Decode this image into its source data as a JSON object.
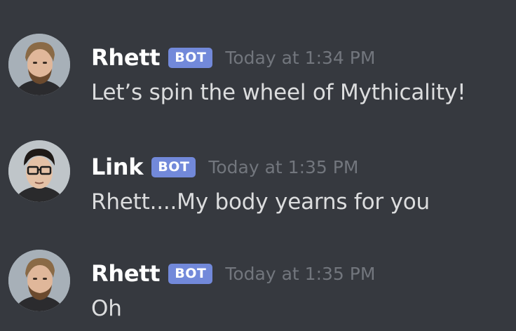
{
  "messages": [
    {
      "username": "Rhett",
      "tag": "BOT",
      "timestamp": "Today at 1:34 PM",
      "text": "Let’s spin the wheel of Mythicality!",
      "avatar_icon": "rhett-avatar-icon"
    },
    {
      "username": "Link",
      "tag": "BOT",
      "timestamp": "Today at 1:35 PM",
      "text": "Rhett....My body yearns for you",
      "avatar_icon": "link-avatar-icon"
    },
    {
      "username": "Rhett",
      "tag": "BOT",
      "timestamp": "Today at 1:35 PM",
      "text": "Oh",
      "avatar_icon": "rhett-avatar-icon"
    }
  ],
  "colors": {
    "background": "#36393f",
    "bot_tag": "#7289da",
    "username": "#ffffff",
    "timestamp": "#72767d",
    "message_text": "#dcddde"
  }
}
